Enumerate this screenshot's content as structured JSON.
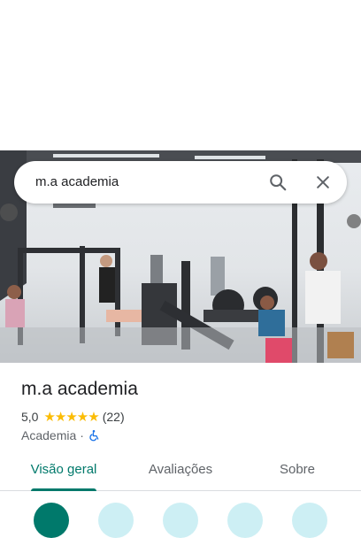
{
  "search": {
    "query": "m.a academia"
  },
  "place": {
    "name": "m.a academia",
    "rating": "5,0",
    "stars": "★★★★★",
    "review_count": "(22)",
    "category": "Academia",
    "separator": "·"
  },
  "tabs": [
    {
      "label": "Visão geral",
      "active": true
    },
    {
      "label": "Avaliações",
      "active": false
    },
    {
      "label": "Sobre",
      "active": false
    }
  ],
  "icons": {
    "search": "search-icon",
    "close": "close-icon",
    "accessibility": "wheelchair-icon"
  },
  "colors": {
    "accent": "#00796b",
    "star": "#fbbc04",
    "accessibility": "#1a73e8"
  }
}
